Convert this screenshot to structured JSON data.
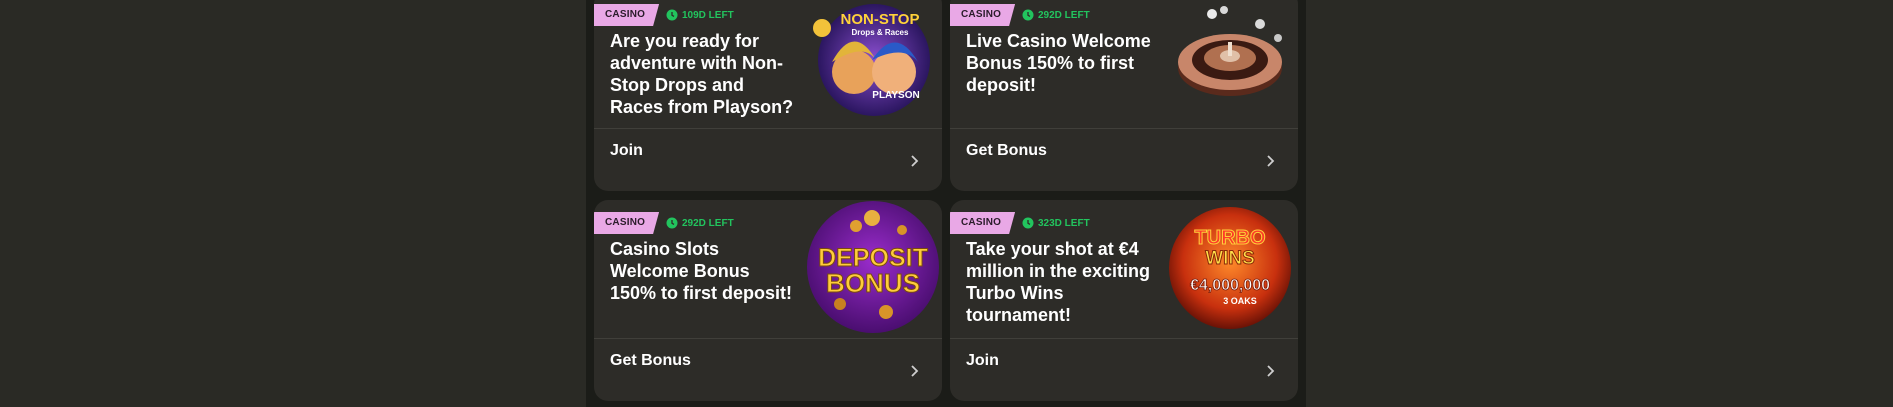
{
  "cards": [
    {
      "badge": "CASINO",
      "timer": "109D LEFT",
      "title": "Are you ready for adventure with Non-Stop Drops and Races from Playson?",
      "action": "Join",
      "art": {
        "line1": "NON-STOP",
        "line2": "Drops & Races",
        "brand": "PLAYSON",
        "colors": [
          "#7a3bb8",
          "#2a1a5a"
        ]
      }
    },
    {
      "badge": "CASINO",
      "timer": "292D LEFT",
      "title": "Live Casino Welcome Bonus 150% to first deposit!",
      "action": "Get Bonus",
      "art": {
        "colors": [
          "#c88a6a",
          "#6a3a2a"
        ]
      }
    },
    {
      "badge": "CASINO",
      "timer": "292D LEFT",
      "title": "Casino Slots Welcome Bonus 150% to first deposit!",
      "action": "Get Bonus",
      "art": {
        "line1": "DEPOSIT",
        "line2": "BONUS",
        "colors": [
          "#7a1fa0",
          "#4a0e70"
        ]
      }
    },
    {
      "badge": "CASINO",
      "timer": "323D LEFT",
      "title": "Take your shot at €4 million in the exciting Turbo Wins tournament!",
      "action": "Join",
      "art": {
        "line1": "TURBO",
        "line2": "WINS",
        "line3": "€4,000,000",
        "line4": "3 OAKS",
        "colors": [
          "#ff7a1a",
          "#8a1a0a"
        ]
      }
    }
  ]
}
